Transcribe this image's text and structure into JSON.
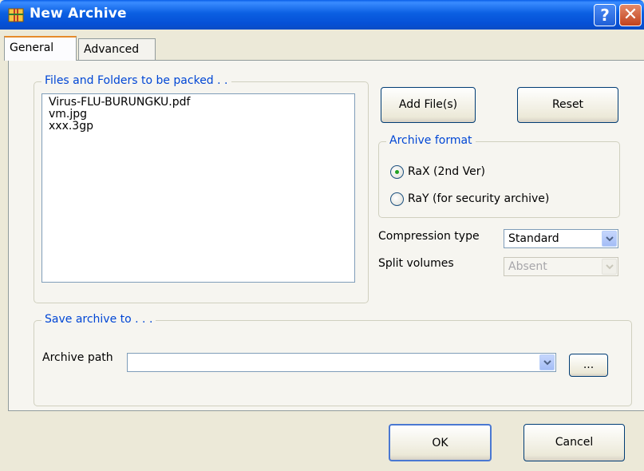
{
  "window": {
    "title": "New Archive",
    "help_label": "?",
    "close_label": "✕"
  },
  "tabs": [
    {
      "label": "General",
      "selected": true
    },
    {
      "label": "Advanced",
      "selected": false
    }
  ],
  "files_group": {
    "legend": "Files and Folders to be packed . .",
    "files": [
      "Virus-FLU-BURUNGKU.pdf",
      "vm.jpg",
      "xxx.3gp"
    ]
  },
  "buttons": {
    "add_files": "Add File(s)",
    "reset": "Reset",
    "ok": "OK",
    "cancel": "Cancel",
    "browse": "..."
  },
  "archive_format": {
    "legend": "Archive format",
    "options": [
      {
        "label": "RaX (2nd Ver)",
        "selected": true
      },
      {
        "label": "RaY (for security archive)",
        "selected": false
      }
    ]
  },
  "compression": {
    "label": "Compression type",
    "value": "Standard"
  },
  "split": {
    "label": "Split volumes",
    "value": "Absent",
    "disabled": true
  },
  "save_group": {
    "legend": "Save archive to . . .",
    "path_label": "Archive path",
    "path_value": ""
  },
  "colors": {
    "legend_text": "#0046d5",
    "titlebar": "#0550d6",
    "selected_radio": "#21a121"
  }
}
